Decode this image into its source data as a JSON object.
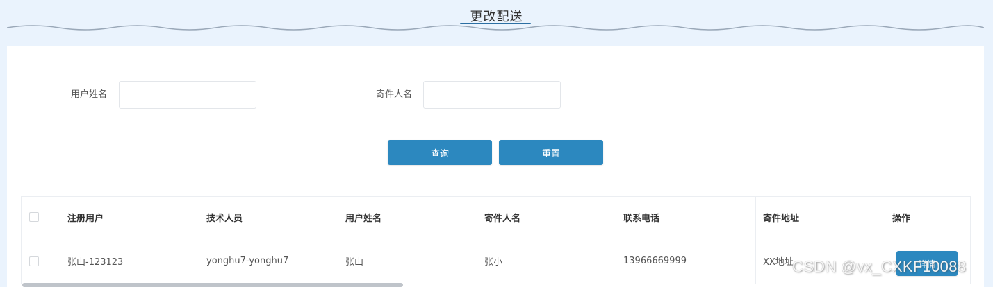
{
  "header": {
    "title": "更改配送"
  },
  "search": {
    "user_name_label": "用户姓名",
    "user_name_value": "",
    "sender_name_label": "寄件人名",
    "sender_name_value": "",
    "query_label": "查询",
    "reset_label": "重置"
  },
  "table": {
    "headers": [
      "注册用户",
      "技术人员",
      "用户姓名",
      "寄件人名",
      "联系电话",
      "寄件地址",
      "操作"
    ],
    "rows": [
      {
        "registered_user": "张山-123123",
        "technician": "yonghu7-yonghu7",
        "user_name": "张山",
        "sender_name": "张小",
        "phone": "13966669999",
        "address": "XX地址",
        "action_label": "详情"
      }
    ]
  },
  "watermark": "CSDN @vx_CXKF10088",
  "colors": {
    "page_background": "#eaf3fd",
    "button_primary": "#2c88bf",
    "title_underline": "#2c6fa3"
  }
}
